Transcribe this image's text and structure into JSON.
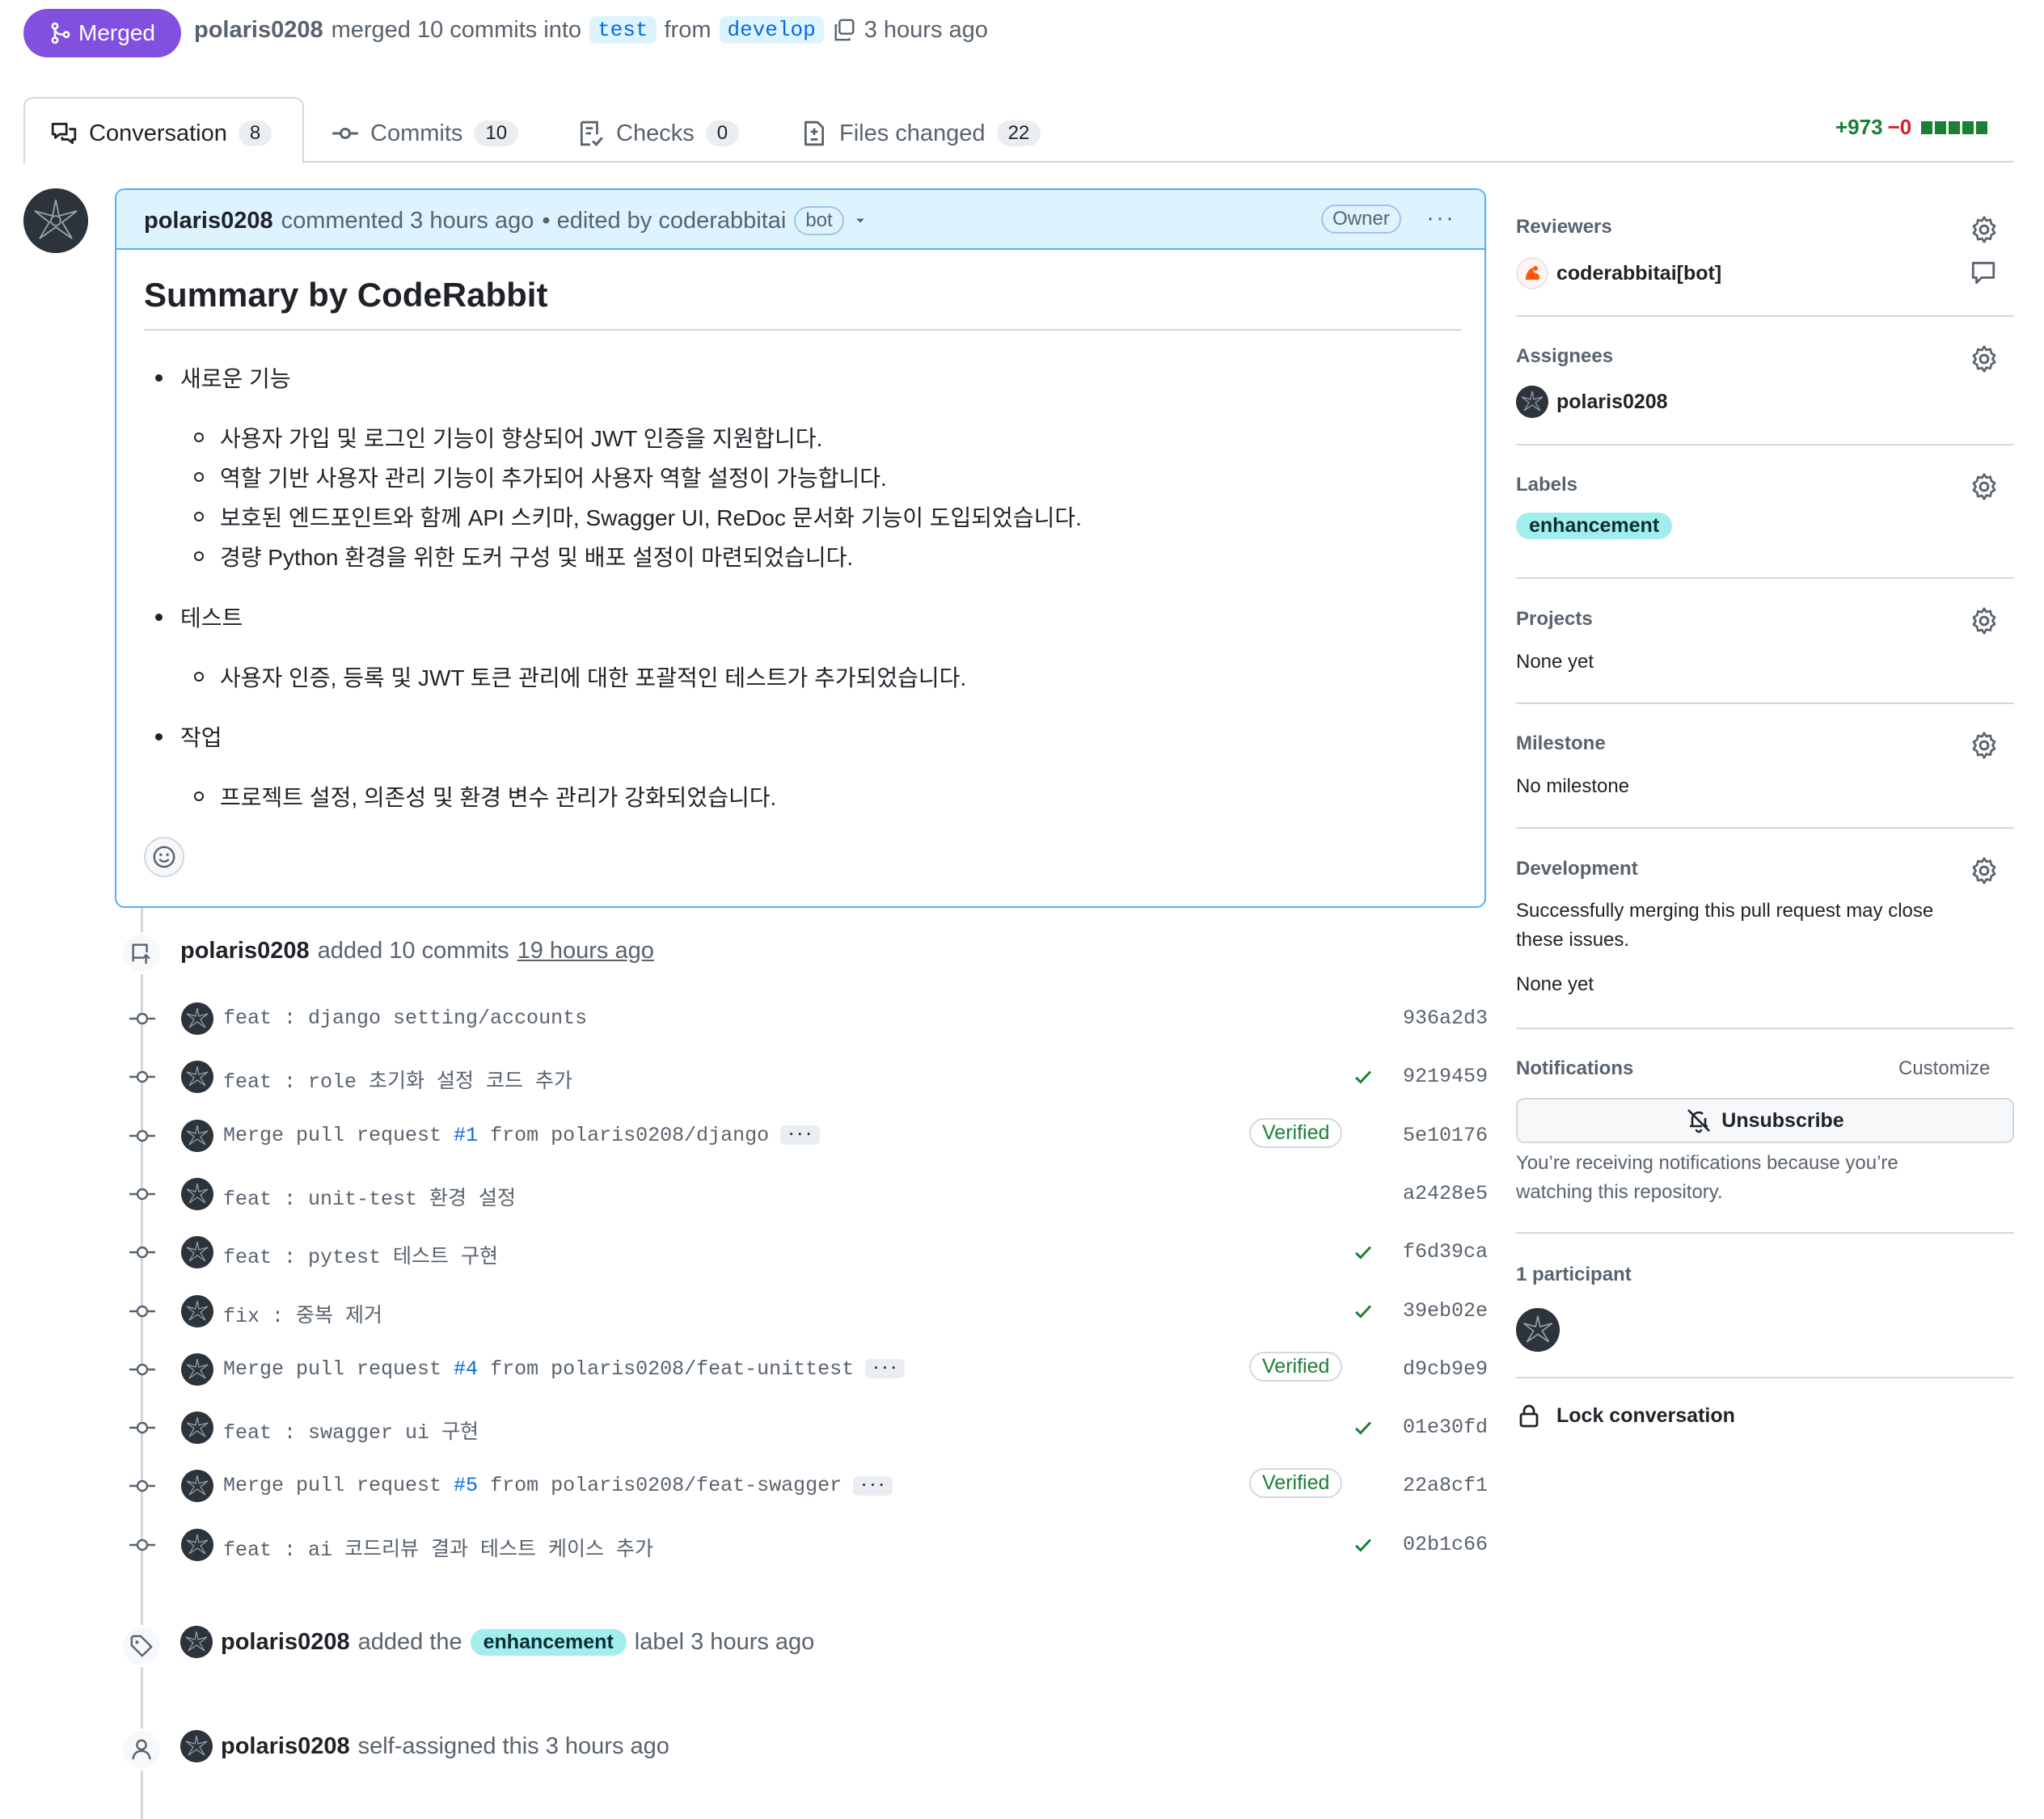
{
  "header": {
    "status": "Merged",
    "author": "polaris0208",
    "merged_text": "merged 10 commits into",
    "base_branch": "test",
    "from_text": "from",
    "head_branch": "develop",
    "time": "3 hours ago"
  },
  "tabs": [
    {
      "label": "Conversation",
      "count": "8",
      "icon": "comment-discussion-icon"
    },
    {
      "label": "Commits",
      "count": "10",
      "icon": "git-commit-icon"
    },
    {
      "label": "Checks",
      "count": "0",
      "icon": "checklist-icon"
    },
    {
      "label": "Files changed",
      "count": "22",
      "icon": "file-diff-icon"
    }
  ],
  "diffstat": {
    "additions": "+973",
    "deletions": "−0"
  },
  "comment": {
    "author": "polaris0208",
    "action": "commented 3 hours ago",
    "edited": "• edited by coderabbitai",
    "bot_label": "bot",
    "owner_label": "Owner",
    "title": "Summary by CodeRabbit",
    "sections": [
      {
        "title": "새로운 기능",
        "items": [
          "사용자 가입 및 로그인 기능이 향상되어 JWT 인증을 지원합니다.",
          "역할 기반 사용자 관리 기능이 추가되어 사용자 역할 설정이 가능합니다.",
          "보호된 엔드포인트와 함께 API 스키마, Swagger UI, ReDoc 문서화 기능이 도입되었습니다.",
          "경량 Python 환경을 위한 도커 구성 및 배포 설정이 마련되었습니다."
        ]
      },
      {
        "title": "테스트",
        "items": [
          "사용자 인증, 등록 및 JWT 토큰 관리에 대한 포괄적인 테스트가 추가되었습니다."
        ]
      },
      {
        "title": "작업",
        "items": [
          "프로젝트 설정, 의존성 및 환경 변수 관리가 강화되었습니다."
        ]
      }
    ]
  },
  "commits_event": {
    "author": "polaris0208",
    "text": "added 10 commits",
    "time": "19 hours ago"
  },
  "commits": [
    {
      "msg": "feat : django setting/accounts",
      "pr": "",
      "rest": "",
      "verified": "",
      "check": false,
      "sha": "936a2d3"
    },
    {
      "msg": "feat : role 초기화 설정 코드 추가",
      "pr": "",
      "rest": "",
      "verified": "",
      "check": true,
      "sha": "9219459"
    },
    {
      "msg": "Merge pull request ",
      "pr": "#1",
      "rest": " from polaris0208/django",
      "verified": "Verified",
      "check": false,
      "sha": "5e10176"
    },
    {
      "msg": "feat : unit-test 환경 설정",
      "pr": "",
      "rest": "",
      "verified": "",
      "check": false,
      "sha": "a2428e5"
    },
    {
      "msg": "feat : pytest 테스트 구현",
      "pr": "",
      "rest": "",
      "verified": "",
      "check": true,
      "sha": "f6d39ca"
    },
    {
      "msg": "fix : 중복 제거",
      "pr": "",
      "rest": "",
      "verified": "",
      "check": true,
      "sha": "39eb02e"
    },
    {
      "msg": "Merge pull request ",
      "pr": "#4",
      "rest": " from polaris0208/feat-unittest",
      "verified": "Verified",
      "check": false,
      "sha": "d9cb9e9"
    },
    {
      "msg": "feat : swagger ui 구현",
      "pr": "",
      "rest": "",
      "verified": "",
      "check": true,
      "sha": "01e30fd"
    },
    {
      "msg": "Merge pull request ",
      "pr": "#5",
      "rest": " from polaris0208/feat-swagger",
      "verified": "Verified",
      "check": false,
      "sha": "22a8cf1"
    },
    {
      "msg": "feat : ai 코드리뷰 결과 테스트 케이스 추가",
      "pr": "",
      "rest": "",
      "verified": "",
      "check": true,
      "sha": "02b1c66"
    }
  ],
  "label_event": {
    "author": "polaris0208",
    "pre": "added the",
    "label": "enhancement",
    "post": "label 3 hours ago"
  },
  "assign_event": {
    "author": "polaris0208",
    "text": "self-assigned this 3 hours ago"
  },
  "sidebar": {
    "reviewers": {
      "title": "Reviewers",
      "name": "coderabbitai[bot]"
    },
    "assignees": {
      "title": "Assignees",
      "name": "polaris0208"
    },
    "labels": {
      "title": "Labels",
      "label": "enhancement"
    },
    "projects": {
      "title": "Projects",
      "value": "None yet"
    },
    "milestone": {
      "title": "Milestone",
      "value": "No milestone"
    },
    "development": {
      "title": "Development",
      "line1": "Successfully merging this pull request may close",
      "line2": "these issues.",
      "value": "None yet"
    },
    "notifications": {
      "title": "Notifications",
      "customize": "Customize",
      "button": "Unsubscribe",
      "line1": "You’re receiving notifications because you’re",
      "line2": "watching this repository."
    },
    "participants": {
      "title": "1 participant"
    },
    "lock": "Lock conversation"
  },
  "colors": {
    "merged": "#8250df",
    "accent_blue": "#0969da",
    "green": "#1a7f37",
    "red": "#cf222e",
    "label": "#a2eeef"
  }
}
